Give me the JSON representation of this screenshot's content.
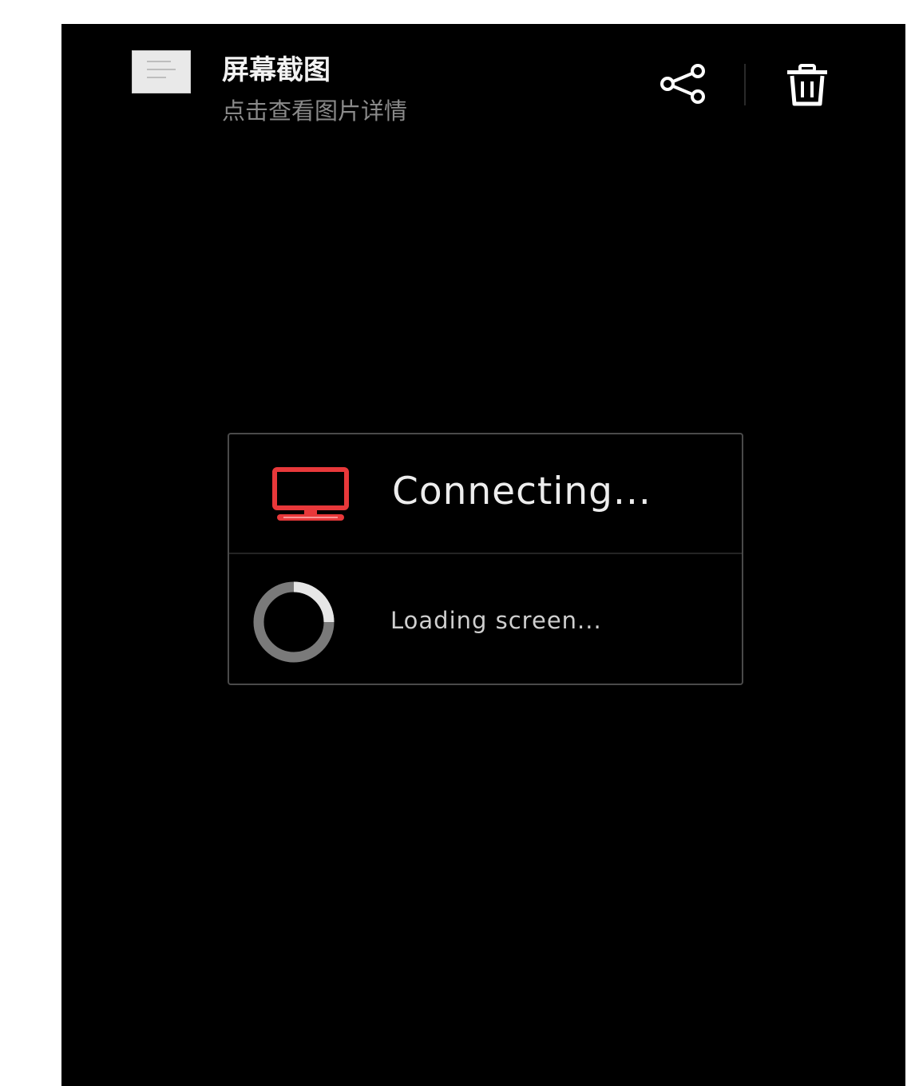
{
  "notification": {
    "title": "屏幕截图",
    "subtitle": "点击查看图片详情",
    "thumbnail_icon": "screenshot-thumbnail",
    "share_icon": "share-icon",
    "delete_icon": "trash-icon"
  },
  "dialog": {
    "title": "Connecting...",
    "message": "Loading screen...",
    "icon": "monitor-icon",
    "accent_color": "#e8383a"
  }
}
